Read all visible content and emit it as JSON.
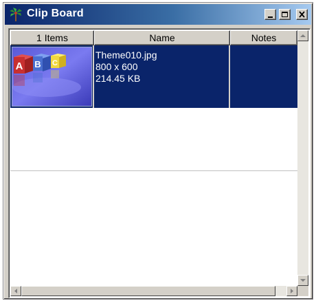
{
  "window": {
    "title": "Clip Board",
    "icon": "palm-tree-icon"
  },
  "columns": {
    "items": "1 Items",
    "name": "Name",
    "notes": "Notes"
  },
  "files": [
    {
      "thumbnail": "abc-blocks-thumbnail",
      "name": "Theme010.jpg",
      "dimensions": "800 x 600",
      "size": "214.45 KB",
      "notes": ""
    }
  ],
  "colors": {
    "selection": "#0a246a",
    "title_gradient_start": "#0a246a",
    "title_gradient_end": "#a6caf0"
  }
}
